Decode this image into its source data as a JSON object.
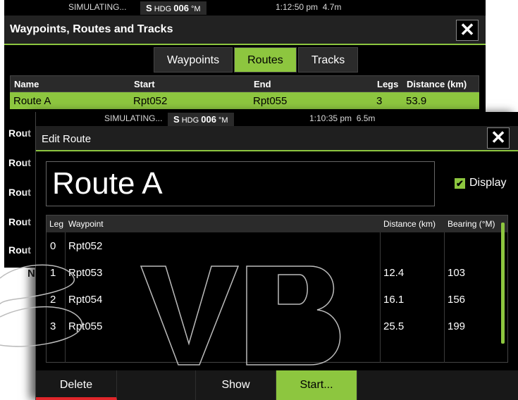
{
  "background_window": {
    "status": {
      "sim": "SIMULATING...",
      "hdg_prefix": "S",
      "hdg_label": "HDG",
      "hdg_value": "006",
      "hdg_unit": "°M",
      "time": "1:12:50 pm",
      "distance": "4.7m"
    },
    "title": "Waypoints, Routes and Tracks",
    "close_label": "✕",
    "tabs": [
      {
        "label": "Waypoints"
      },
      {
        "label": "Routes"
      },
      {
        "label": "Tracks"
      }
    ],
    "table": {
      "headers": {
        "name": "Name",
        "start": "Start",
        "end": "End",
        "legs": "Legs",
        "distance": "Distance (km)"
      },
      "selected_row": {
        "name": "Route A",
        "start": "Rpt052",
        "end": "Rpt055",
        "legs": "3",
        "distance": "53.9"
      },
      "partial_rows": [
        "Rout",
        "Rout",
        "Rout",
        "Rout",
        "Rout"
      ],
      "partial_bottom": "N"
    }
  },
  "edit_window": {
    "status": {
      "sim": "SIMULATING...",
      "hdg_prefix": "S",
      "hdg_label": "HDG",
      "hdg_value": "006",
      "hdg_unit": "°M",
      "time": "1:10:35 pm",
      "distance": "6.5m"
    },
    "title": "Edit Route",
    "close_label": "✕",
    "route_name": "Route A",
    "display_label": "Display",
    "display_checked": true,
    "table": {
      "headers": {
        "leg": "Leg",
        "waypoint": "Waypoint",
        "distance": "Distance (km)",
        "bearing": "Bearing (°M)"
      },
      "rows": [
        {
          "leg": "0",
          "waypoint": "Rpt052",
          "distance": "",
          "bearing": ""
        },
        {
          "leg": "1",
          "waypoint": "Rpt053",
          "distance": "12.4",
          "bearing": "103"
        },
        {
          "leg": "2",
          "waypoint": "Rpt054",
          "distance": "16.1",
          "bearing": "156"
        },
        {
          "leg": "3",
          "waypoint": "Rpt055",
          "distance": "25.5",
          "bearing": "199"
        }
      ]
    },
    "buttons": {
      "delete": "Delete",
      "show": "Show",
      "start": "Start..."
    }
  },
  "colors": {
    "accent": "#8dc63f",
    "danger": "#e0262a",
    "background": "#000000"
  }
}
